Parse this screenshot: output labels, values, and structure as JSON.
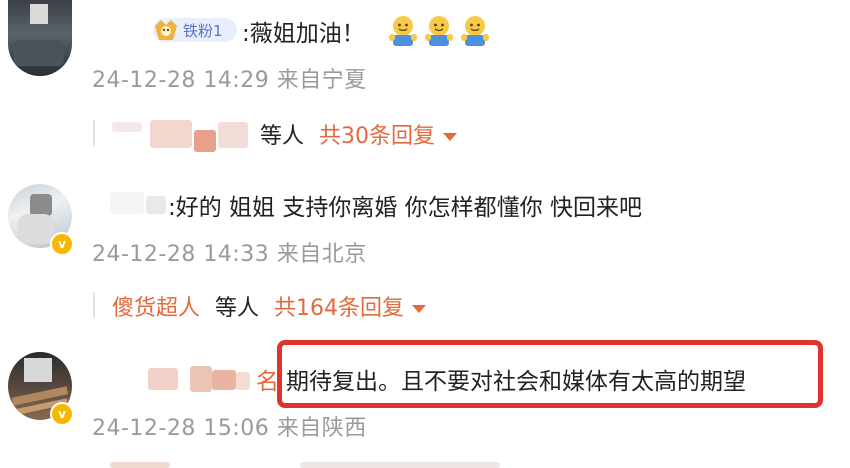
{
  "comments": [
    {
      "fan_badge": "铁粉1",
      "text": ":薇姐加油！",
      "meta": "24-12-28 14:29 来自宁夏",
      "reply": {
        "tail": "等人",
        "count": "共30条回复"
      }
    },
    {
      "text": ":好的 姐姐 支持你离婚 你怎样都懂你 快回来吧",
      "meta": "24-12-28 14:33 来自北京",
      "reply": {
        "name": "傻货超人",
        "tail": "等人",
        "count": "共164条回复"
      }
    },
    {
      "name_fragment": "名",
      "text": "期待复出。且不要对社会和媒体有太高的期望",
      "meta": "24-12-28 15:06 来自陕西"
    }
  ],
  "colors": {
    "link": "#e36a3d",
    "meta": "#9a9a9a",
    "highlight": "#e0322f",
    "verified": "#f5b700"
  },
  "icons": [
    "smile-emoji-icon",
    "fan-badge-icon",
    "verified-icon",
    "dropdown-caret-icon"
  ]
}
